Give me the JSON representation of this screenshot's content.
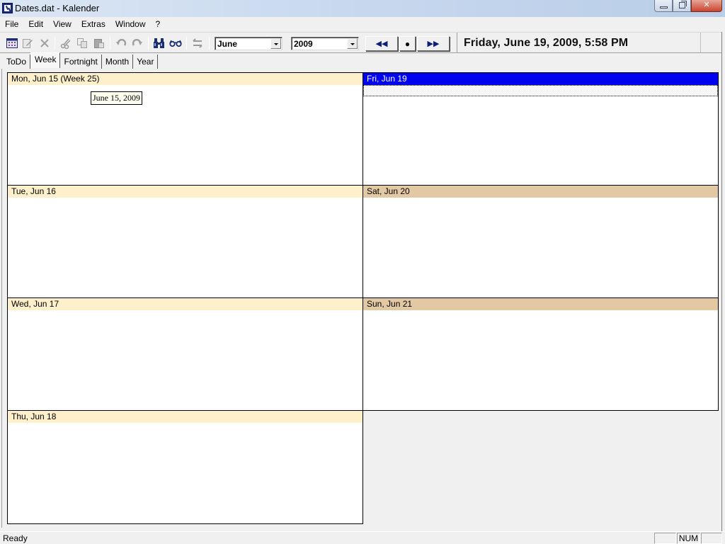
{
  "window": {
    "title": "Dates.dat - Kalender",
    "icon": "calendar-clock-icon",
    "controls": {
      "minimize": "minimize-icon",
      "maximize": "restore-icon",
      "close": "close-icon"
    }
  },
  "menu": [
    "File",
    "Edit",
    "View",
    "Extras",
    "Window",
    "?"
  ],
  "toolbar": {
    "icons": [
      "calendar-icon",
      "edit-icon",
      "delete-icon",
      "cut-icon",
      "copy-icon",
      "paste-icon",
      "undo-icon",
      "redo-icon",
      "find-icon",
      "view-glasses-icon",
      "swap-arrows-icon"
    ],
    "month": "June",
    "year": "2009",
    "nav": {
      "prev": "rewind-icon",
      "today": "today-dot-icon",
      "next": "fast-forward-icon"
    },
    "clock": "Friday, June 19, 2009, 5:58 PM"
  },
  "tabs": [
    {
      "label": "ToDo",
      "active": false
    },
    {
      "label": "Week",
      "active": true
    },
    {
      "label": "Fortnight",
      "active": false
    },
    {
      "label": "Month",
      "active": false
    },
    {
      "label": "Year",
      "active": false
    }
  ],
  "week": {
    "days": [
      {
        "label": "Mon, Jun 15 (Week 25)",
        "type": "weekday"
      },
      {
        "label": "Tue, Jun 16",
        "type": "weekday"
      },
      {
        "label": "Wed, Jun 17",
        "type": "weekday"
      },
      {
        "label": "Thu, Jun 18",
        "type": "weekday"
      },
      {
        "label": "Fri, Jun 19",
        "type": "selected"
      },
      {
        "label": "Sat, Jun 20",
        "type": "weekend"
      },
      {
        "label": "Sun, Jun 21",
        "type": "weekend"
      }
    ],
    "tooltip": "June 15, 2009"
  },
  "colors": {
    "weekday_header": "#fff0cc",
    "weekend_header": "#e2c9a3",
    "selected_header": "#0000f0"
  },
  "status": {
    "text": "Ready",
    "panes": [
      "",
      "NUM",
      ""
    ]
  }
}
